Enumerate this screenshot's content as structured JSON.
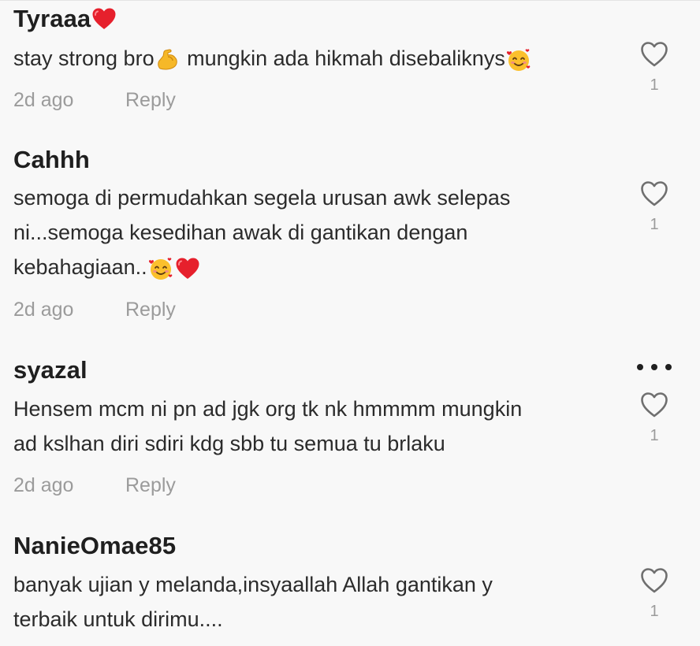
{
  "comments": [
    {
      "username": "Tyraaa",
      "username_emoji": "red-heart",
      "text_before": "stay strong bro",
      "emoji_1": "flexed-biceps",
      "text_middle": " mungkin ada hikmah disebaliknys",
      "emoji_2": "smiling-face-with-hearts",
      "time": "2d ago",
      "reply_label": "Reply",
      "likes": "1"
    },
    {
      "username": "Cahhh",
      "lines": [
        "semoga di permudahkan segela urusan awk selepas",
        "ni...semoga kesedihan awak di gantikan dengan",
        "kebahagiaan.."
      ],
      "trailing_emojis": [
        "smiling-face-with-hearts",
        "red-heart"
      ],
      "time": "2d ago",
      "reply_label": "Reply",
      "likes": "1"
    },
    {
      "username": "syazal",
      "lines": [
        "Hensem mcm ni pn ad jgk org tk nk hmmmm mungkin",
        "ad kslhan diri sdiri kdg sbb tu semua tu brlaku"
      ],
      "more_icon": "more-horizontal-icon",
      "time": "2d ago",
      "reply_label": "Reply",
      "likes": "1"
    },
    {
      "username": "NanieOmae85",
      "lines": [
        "banyak ujian y melanda,insyaallah Allah gantikan y",
        "terbaik untuk dirimu...."
      ],
      "likes": "1"
    }
  ],
  "colors": {
    "background": "#f8f8f8",
    "username": "#1f1f1f",
    "text": "#2b2b2b",
    "meta": "#9b9b9b",
    "heart_outline": "#6f6f6f"
  }
}
